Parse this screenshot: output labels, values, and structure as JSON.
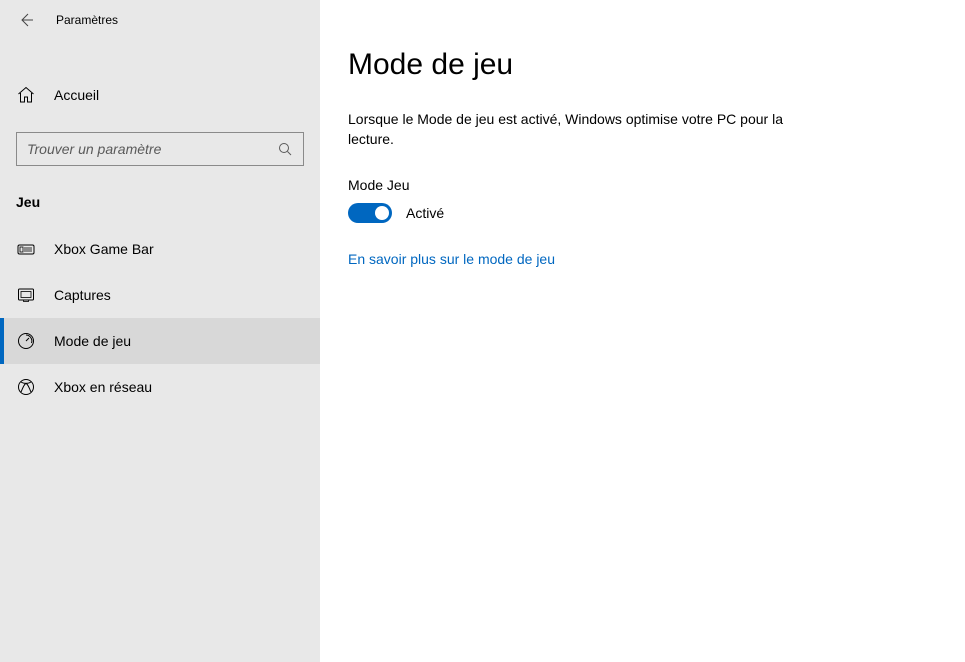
{
  "header": {
    "title": "Paramètres"
  },
  "sidebar": {
    "home_label": "Accueil",
    "search_placeholder": "Trouver un paramètre",
    "section_label": "Jeu",
    "items": [
      {
        "label": "Xbox Game Bar",
        "icon": "game-bar-icon",
        "active": false
      },
      {
        "label": "Captures",
        "icon": "captures-icon",
        "active": false
      },
      {
        "label": "Mode de jeu",
        "icon": "game-mode-icon",
        "active": true
      },
      {
        "label": "Xbox en réseau",
        "icon": "xbox-network-icon",
        "active": false
      }
    ]
  },
  "main": {
    "title": "Mode de jeu",
    "description": "Lorsque le Mode de jeu est activé, Windows optimise votre PC pour la lecture.",
    "toggle_label": "Mode Jeu",
    "toggle_state": "Activé",
    "link_text": "En savoir plus sur le mode de jeu"
  },
  "colors": {
    "accent": "#0067c0",
    "sidebar_bg": "#e8e8e8"
  }
}
